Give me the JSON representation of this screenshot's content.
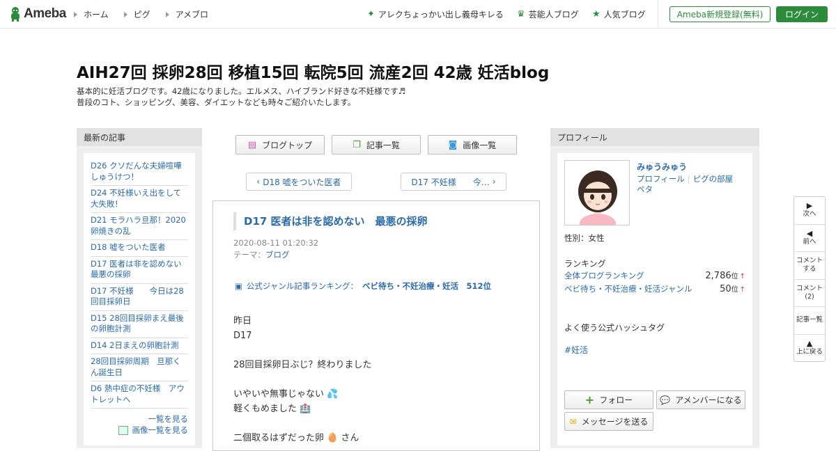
{
  "header": {
    "logo_text": "Ameba",
    "global_nav": [
      "ホーム",
      "ピグ",
      "アメブロ"
    ],
    "links": [
      {
        "label": "アレクちょっかい出し義母キレる",
        "icon": "sparkle-icon"
      },
      {
        "label": "芸能人ブログ",
        "icon": "crown-icon"
      },
      {
        "label": "人気ブログ",
        "icon": "star-icon"
      }
    ],
    "register_label": "Ameba新規登録(無料)",
    "login_label": "ログイン",
    "accent_color": "#2d8c3c"
  },
  "blog": {
    "title": "AIH27回 採卵28回 移植15回 転院5回 流産2回 42歳 妊活blog",
    "description_line1": "基本的に妊活ブログです。42歳になりました。エルメス、ハイブランド好きな不妊様です♬",
    "description_line2": "普段のコト、ショッピング、美容、ダイエットなども時々ご紹介いたします。"
  },
  "left_sidebar": {
    "heading": "最新の記事",
    "items": [
      "D26 クソだんな夫婦喧嘩しゅうけつ！",
      "D24 不妊様いえ出をして大失敗！",
      "D21 モラハラ旦那！2020卵焼きの乱",
      "D18 嘘をついた医者",
      "D17 医者は非を認めない　最悪の採卵",
      "D17 不妊様　　今日は28回目採卵日",
      "D15 28回目採卵まえ最後の卵胞計測",
      "D14 2日まえの卵胞計測",
      "28回目採卵周期　旦那くん誕生日",
      "D6 熱中症の不妊様　アウトレットへ"
    ],
    "more_label": "一覧を見る",
    "images_label": "画像一覧を見る"
  },
  "center": {
    "top_buttons": [
      "ブログトップ",
      "記事一覧",
      "画像一覧"
    ],
    "prev_label": "D18 嘘をついた医者",
    "next_label": "D17 不妊様　　今…",
    "article": {
      "title": "D17 医者は非を認めない　最悪の採卵",
      "date": "2020-08-11 01:20:32",
      "theme_label": "テーマ：",
      "theme_value": "ブログ",
      "ranking_label": "公式ジャンル記事ランキング：",
      "ranking_value": "ベビ待ち・不妊治療・妊活　512位",
      "body": [
        "昨日",
        "D17",
        "",
        "28回目採卵日ぶじ？終わりました",
        "",
        "いやいや無事じゃない 💦",
        "軽くもめました 🏥",
        "",
        "二個取るはずだった卵 🥚 さん"
      ]
    }
  },
  "right_sidebar": {
    "heading": "プロフィール",
    "name": "みゅうみゅう",
    "link_profile": "プロフィール",
    "link_pig_room": "ピグの部屋",
    "link_peta": "ペタ",
    "gender": "性別：女性",
    "ranking_title": "ランキング",
    "rankings": [
      {
        "label": "全体ブログランキング",
        "value": "2,786",
        "unit": "位",
        "trend": "↑"
      },
      {
        "label": "ベビ待ち・不妊治療・妊活ジャンル",
        "value": "50",
        "unit": "位",
        "trend": "↑"
      }
    ],
    "hashtag_title": "よく使う公式ハッシュタグ",
    "hashtag": "#妊活",
    "follow_label": "フォロー",
    "amember_label": "アメンバーになる",
    "message_label": "メッセージを送る"
  },
  "float_tools": {
    "next": "次へ",
    "prev": "前へ",
    "comment_line1": "コメント",
    "comment_line2": "する",
    "comments_line1": "コメント",
    "comments_line2": "(2)",
    "list": "記事一覧",
    "top": "上に戻る"
  }
}
